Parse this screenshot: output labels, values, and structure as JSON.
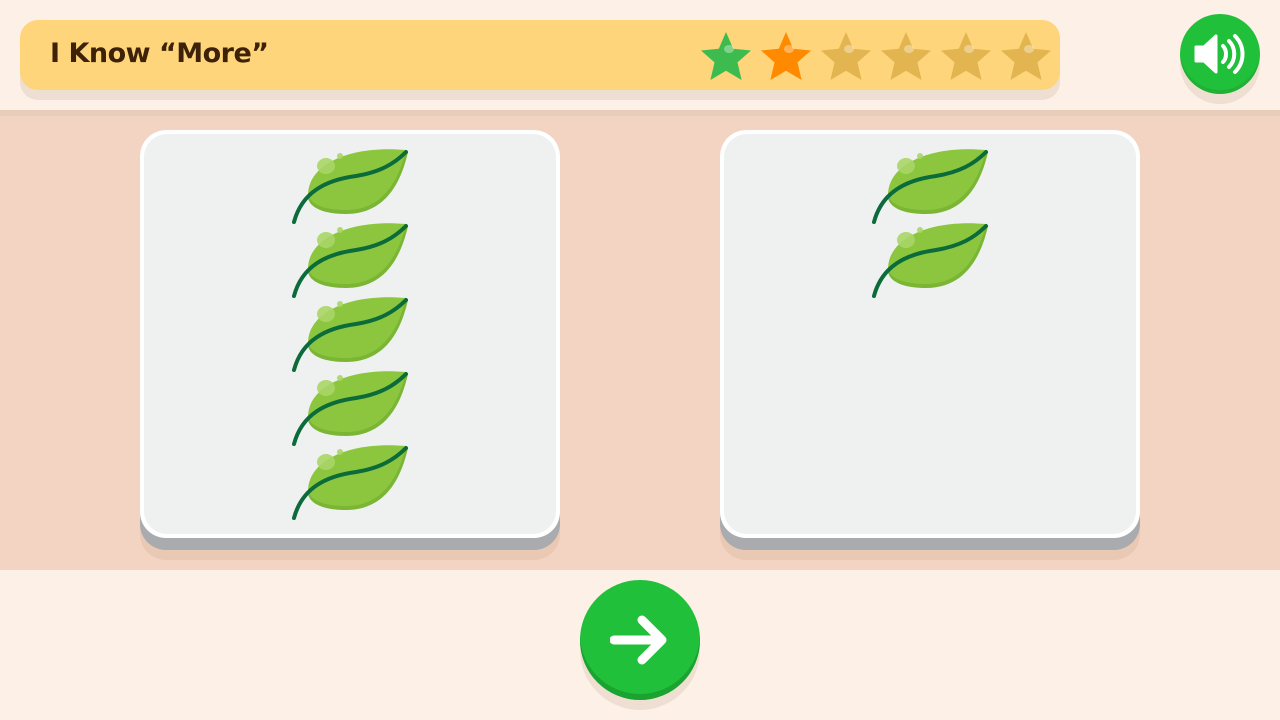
{
  "header": {
    "title": "I Know “More”",
    "progress": {
      "total_stars": 6,
      "completed": 1,
      "current": 2
    },
    "star_colors": {
      "completed": "#3dbb4f",
      "current": "#ff8a00",
      "pending": "#e3b550"
    }
  },
  "sound_button": {
    "icon": "speaker-icon",
    "color": "#21c03b"
  },
  "cards": [
    {
      "leaf_count": 5
    },
    {
      "leaf_count": 2
    }
  ],
  "leaf": {
    "icon": "leaf-icon",
    "fill": "#8cc63e",
    "stem": "#0b6b3a"
  },
  "next_button": {
    "icon": "arrow-right-icon",
    "color": "#21c03b"
  }
}
